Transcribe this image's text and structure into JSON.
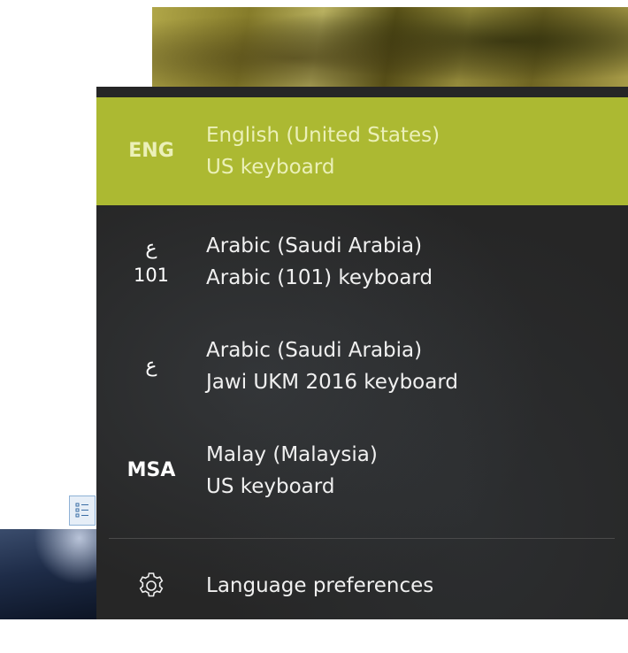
{
  "languages": [
    {
      "code": "ENG",
      "code_sub": "",
      "name": "English (United States)",
      "keyboard": "US keyboard",
      "selected": true
    },
    {
      "code": "ع",
      "code_sub": "101",
      "name": "Arabic (Saudi Arabia)",
      "keyboard": "Arabic (101) keyboard",
      "selected": false
    },
    {
      "code": "ع",
      "code_sub": "",
      "name": "Arabic (Saudi Arabia)",
      "keyboard": "Jawi UKM 2016 keyboard",
      "selected": false
    },
    {
      "code": "MSA",
      "code_sub": "",
      "name": "Malay (Malaysia)",
      "keyboard": "US keyboard",
      "selected": false
    }
  ],
  "preferences": {
    "label": "Language preferences",
    "icon": "gear-icon"
  },
  "colors": {
    "accent": "#acb932",
    "flyout_bg": "#262626"
  }
}
